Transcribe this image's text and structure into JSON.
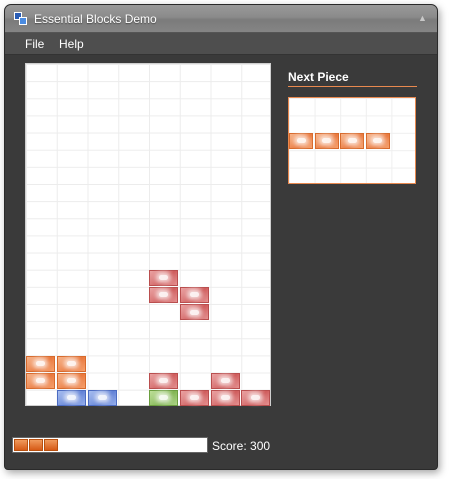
{
  "window": {
    "title": "Essential Blocks Demo",
    "icon": "app-blocks-icon",
    "collapse_icon": "chevron-up-icon",
    "collapse_glyph": "▲"
  },
  "menu": {
    "items": [
      {
        "label": "File"
      },
      {
        "label": "Help"
      }
    ]
  },
  "board": {
    "columns": 8,
    "rows": 20,
    "cells": [
      {
        "row": 12,
        "col": 4,
        "color": "red"
      },
      {
        "row": 13,
        "col": 4,
        "color": "red"
      },
      {
        "row": 13,
        "col": 5,
        "color": "red"
      },
      {
        "row": 14,
        "col": 5,
        "color": "red"
      },
      {
        "row": 17,
        "col": 0,
        "color": "orange"
      },
      {
        "row": 17,
        "col": 1,
        "color": "orange"
      },
      {
        "row": 18,
        "col": 0,
        "color": "orange"
      },
      {
        "row": 18,
        "col": 1,
        "color": "orange"
      },
      {
        "row": 18,
        "col": 4,
        "color": "red"
      },
      {
        "row": 18,
        "col": 6,
        "color": "red"
      },
      {
        "row": 19,
        "col": 1,
        "color": "blue"
      },
      {
        "row": 19,
        "col": 2,
        "color": "blue"
      },
      {
        "row": 19,
        "col": 4,
        "color": "green"
      },
      {
        "row": 19,
        "col": 5,
        "color": "red"
      },
      {
        "row": 19,
        "col": 6,
        "color": "red"
      },
      {
        "row": 19,
        "col": 7,
        "color": "red"
      }
    ]
  },
  "next_piece": {
    "title": "Next Piece",
    "columns": 5,
    "rows": 5,
    "cells": [
      {
        "row": 2,
        "col": 0,
        "color": "orange"
      },
      {
        "row": 2,
        "col": 1,
        "color": "orange"
      },
      {
        "row": 2,
        "col": 2,
        "color": "orange"
      },
      {
        "row": 2,
        "col": 3,
        "color": "orange"
      }
    ]
  },
  "status": {
    "progress_segments": 3,
    "score_label": "Score: 300"
  },
  "colors": {
    "accent": "#e9894f",
    "window_bg": "#3a3a3a",
    "orange": "#e9763a",
    "red": "#cf5b5b",
    "blue": "#5f80d6",
    "green": "#7fb44f"
  }
}
